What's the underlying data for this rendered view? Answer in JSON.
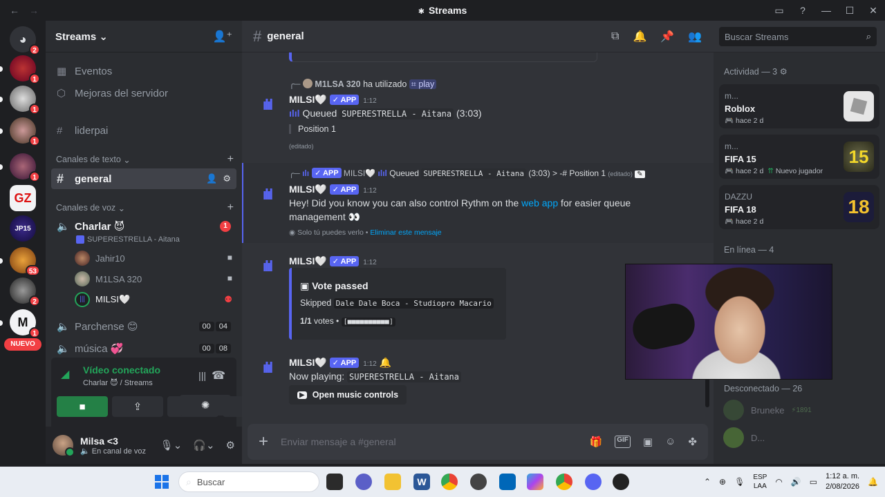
{
  "window": {
    "title": "Streams"
  },
  "rail": {
    "nuevo": "NUEVO",
    "badges": [
      "2",
      "1",
      "1",
      "1",
      "1",
      "1",
      "53",
      "2",
      "1"
    ]
  },
  "sidebar": {
    "guild_name": "Streams",
    "top_items": [
      {
        "label": "Eventos"
      },
      {
        "label": "Mejoras del servidor"
      },
      {
        "label": "liderpai"
      }
    ],
    "text_category": "Canales de texto",
    "text_channel": "general",
    "voice_category": "Canales de voz",
    "voice_channels": [
      {
        "name": "Charlar",
        "emoji": "😈",
        "badge": "1"
      },
      {
        "name": "Parchense",
        "emoji": "😊",
        "c1": "00",
        "c2": "04"
      },
      {
        "name": "música",
        "emoji": "💞",
        "c1": "00",
        "c2": "08"
      }
    ],
    "stream_title": "SUPERESTRELLA - Aitana",
    "voice_users": [
      {
        "name": "Jahir10"
      },
      {
        "name": "M1LSA 320"
      },
      {
        "name": "MILSI🤍"
      }
    ],
    "voice_panel": {
      "title": "Vídeo conectado",
      "sub_channel": "Charlar 😈",
      "sub_server": "/ Streams"
    },
    "user": {
      "name": "Milsa <3",
      "status": "En canal de voz"
    }
  },
  "header": {
    "channel": "general"
  },
  "messages": {
    "m1": {
      "reply_user": "M1LSA 320",
      "reply_text": "ha utilizado",
      "reply_cmd": "play",
      "author": "MILSI🤍",
      "tag": "✓ APP",
      "time": "1:12",
      "queued": "Queued",
      "song": "SUPERESTRELLA - Aitana",
      "duration": "(3:03)",
      "position": "Position 1",
      "edited": "(editado)"
    },
    "m2": {
      "reply_tag": "✓ APP",
      "reply_author": "MILSI🤍",
      "reply_queued": "Queued",
      "reply_song": "SUPERESTRELLA - Aitana",
      "reply_rest": "(3:03) > -# Position 1",
      "reply_edited": "(editado)",
      "author": "MILSI🤍",
      "tag": "✓ APP",
      "time": "1:12",
      "text1": "Hey! Did you know you can also control Rythm on the",
      "link": "web app",
      "text2": "for easier queue",
      "text3": "management 👀",
      "ephemeral": "Solo tú puedes verlo •",
      "dismiss": "Eliminar este mensaje"
    },
    "m3": {
      "author": "MILSI🤍",
      "tag": "✓ APP",
      "time": "1:12",
      "embed_title": "Vote passed",
      "skipped": "Skipped",
      "skipped_song": "Dale Dale Boca - Studiopro Macario",
      "votes_num": "1/1",
      "votes_text": "votes •",
      "votes_bar": "[■■■■■■■■■■]"
    },
    "m4": {
      "author": "MILSI🤍",
      "tag": "✓ APP",
      "time": "1:12",
      "now_playing": "Now playing:",
      "song": "SUPERESTRELLA - Aitana",
      "button": "Open music controls"
    }
  },
  "composer": {
    "placeholder": "Enviar mensaje a #general"
  },
  "search": {
    "placeholder": "Buscar Streams"
  },
  "activity": {
    "heading": "Actividad — 3",
    "cards": [
      {
        "who": "m...",
        "game": "Roblox",
        "ago": "hace 2 d",
        "extra": ""
      },
      {
        "who": "m...",
        "game": "FIFA 15",
        "ago": "hace 2 d",
        "extra": "Nuevo jugador"
      },
      {
        "who": "DAZZU",
        "game": "FIFA 18",
        "ago": "hace 2 d",
        "extra": ""
      }
    ],
    "online": "En línea — 4",
    "offline": "Desconectado — 26",
    "members": [
      {
        "name": "Bruneke",
        "tag": "⚡1891"
      },
      {
        "name": "D..."
      }
    ]
  },
  "taskbar": {
    "search_placeholder": "Buscar",
    "lang1": "ESP",
    "lang2": "LAA",
    "time": "1:12 a. m.",
    "date": "2/08/2026"
  }
}
